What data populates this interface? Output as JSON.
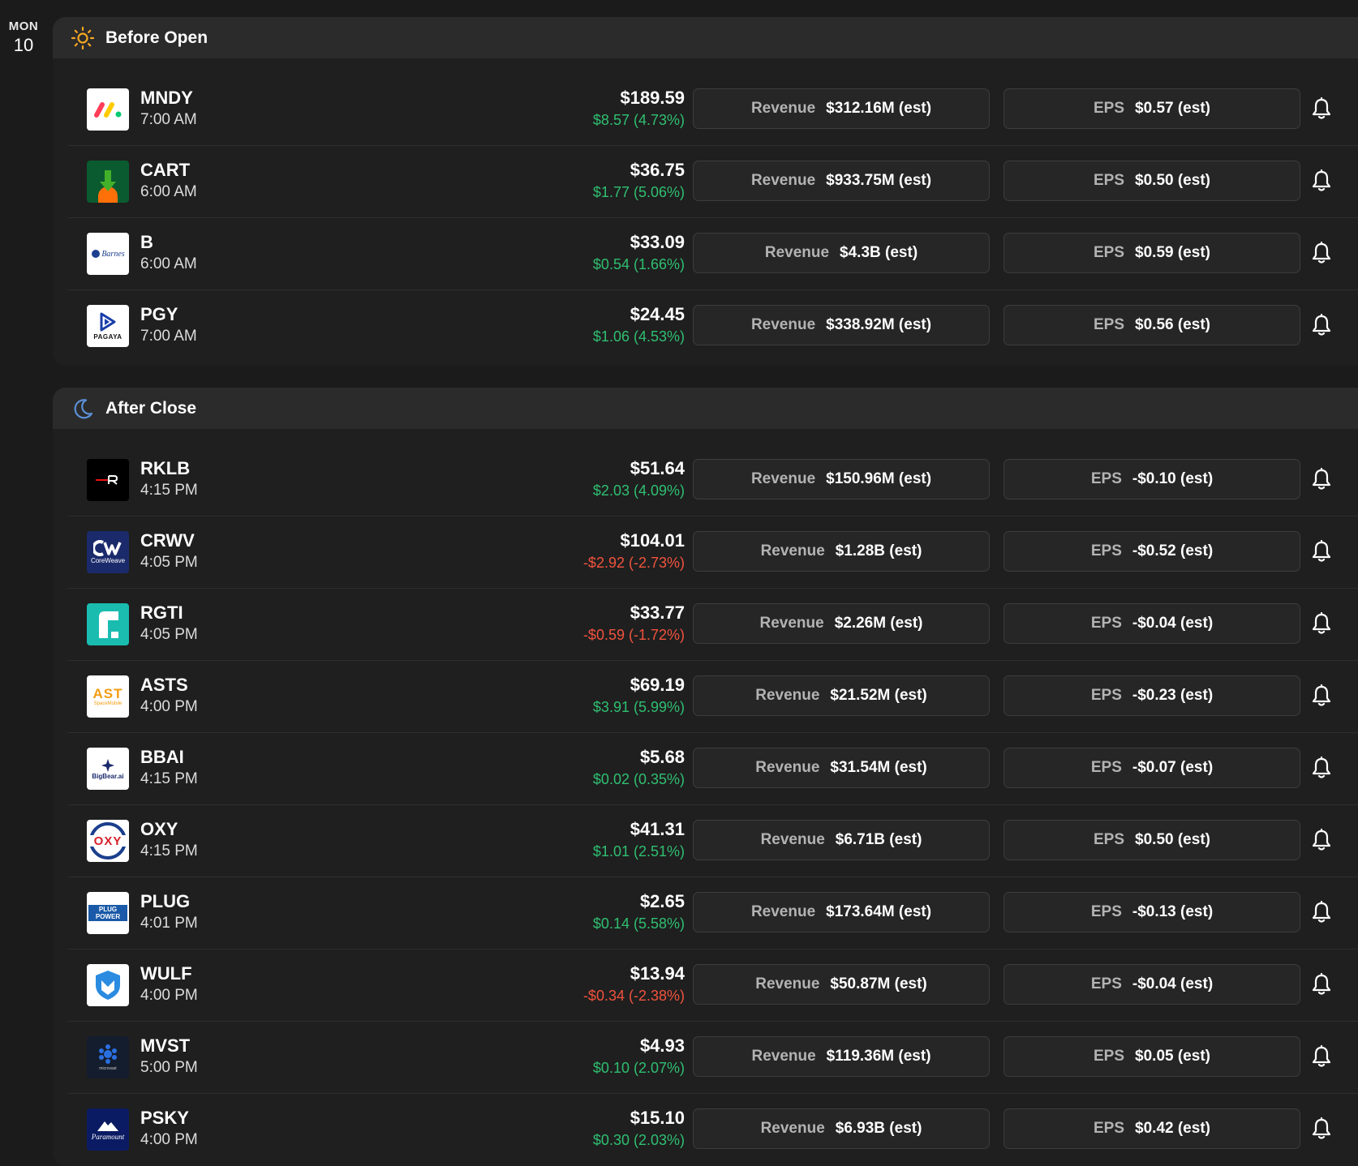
{
  "date": {
    "dow": "MON",
    "day": "10"
  },
  "labels": {
    "revenue": "Revenue",
    "eps": "EPS"
  },
  "sections": [
    {
      "id": "before",
      "title": "Before Open",
      "icon": "sun-icon",
      "rows": [
        {
          "ticker": "MNDY",
          "time": "7:00 AM",
          "price": "$189.59",
          "change": "$8.57 (4.73%)",
          "direction": "up",
          "revenue": "$312.16M (est)",
          "eps": "$0.57 (est)",
          "logo": "monday-logo"
        },
        {
          "ticker": "CART",
          "time": "6:00 AM",
          "price": "$36.75",
          "change": "$1.77 (5.06%)",
          "direction": "up",
          "revenue": "$933.75M (est)",
          "eps": "$0.50 (est)",
          "logo": "instacart-logo"
        },
        {
          "ticker": "B",
          "time": "6:00 AM",
          "price": "$33.09",
          "change": "$0.54 (1.66%)",
          "direction": "up",
          "revenue": "$4.3B (est)",
          "eps": "$0.59 (est)",
          "logo": "barnes-logo",
          "logo_text": "Barnes"
        },
        {
          "ticker": "PGY",
          "time": "7:00 AM",
          "price": "$24.45",
          "change": "$1.06 (4.53%)",
          "direction": "up",
          "revenue": "$338.92M (est)",
          "eps": "$0.56 (est)",
          "logo": "pagaya-logo",
          "logo_text": "PAGAYA"
        }
      ]
    },
    {
      "id": "after",
      "title": "After Close",
      "icon": "moon-icon",
      "rows": [
        {
          "ticker": "RKLB",
          "time": "4:15 PM",
          "price": "$51.64",
          "change": "$2.03 (4.09%)",
          "direction": "up",
          "revenue": "$150.96M (est)",
          "eps": "-$0.10 (est)",
          "logo": "rocketlab-logo"
        },
        {
          "ticker": "CRWV",
          "time": "4:05 PM",
          "price": "$104.01",
          "change": "-$2.92 (-2.73%)",
          "direction": "down",
          "revenue": "$1.28B (est)",
          "eps": "-$0.52 (est)",
          "logo": "coreweave-logo",
          "logo_text": "CoreWeave"
        },
        {
          "ticker": "RGTI",
          "time": "4:05 PM",
          "price": "$33.77",
          "change": "-$0.59 (-1.72%)",
          "direction": "down",
          "revenue": "$2.26M (est)",
          "eps": "-$0.04 (est)",
          "logo": "rigetti-logo"
        },
        {
          "ticker": "ASTS",
          "time": "4:00 PM",
          "price": "$69.19",
          "change": "$3.91 (5.99%)",
          "direction": "up",
          "revenue": "$21.52M (est)",
          "eps": "-$0.23 (est)",
          "logo": "ast-logo",
          "logo_text": "AST",
          "logo_subtext": "SpaceMobile"
        },
        {
          "ticker": "BBAI",
          "time": "4:15 PM",
          "price": "$5.68",
          "change": "$0.02 (0.35%)",
          "direction": "up",
          "revenue": "$31.54M (est)",
          "eps": "-$0.07 (est)",
          "logo": "bigbear-logo",
          "logo_text": "BigBear.ai"
        },
        {
          "ticker": "OXY",
          "time": "4:15 PM",
          "price": "$41.31",
          "change": "$1.01 (2.51%)",
          "direction": "up",
          "revenue": "$6.71B (est)",
          "eps": "$0.50 (est)",
          "logo": "oxy-logo",
          "logo_text": "OXY"
        },
        {
          "ticker": "PLUG",
          "time": "4:01 PM",
          "price": "$2.65",
          "change": "$0.14 (5.58%)",
          "direction": "up",
          "revenue": "$173.64M (est)",
          "eps": "-$0.13 (est)",
          "logo": "plug-logo",
          "logo_text": "PLUG",
          "logo_subtext": "POWER"
        },
        {
          "ticker": "WULF",
          "time": "4:00 PM",
          "price": "$13.94",
          "change": "-$0.34 (-2.38%)",
          "direction": "down",
          "revenue": "$50.87M (est)",
          "eps": "-$0.04 (est)",
          "logo": "terawulf-logo"
        },
        {
          "ticker": "MVST",
          "time": "5:00 PM",
          "price": "$4.93",
          "change": "$0.10 (2.07%)",
          "direction": "up",
          "revenue": "$119.36M (est)",
          "eps": "$0.05 (est)",
          "logo": "microvast-logo",
          "logo_text": "microvast"
        },
        {
          "ticker": "PSKY",
          "time": "4:00 PM",
          "price": "$15.10",
          "change": "$0.30 (2.03%)",
          "direction": "up",
          "revenue": "$6.93B (est)",
          "eps": "$0.42 (est)",
          "logo": "paramount-logo",
          "logo_text": "Paramount"
        }
      ]
    }
  ]
}
